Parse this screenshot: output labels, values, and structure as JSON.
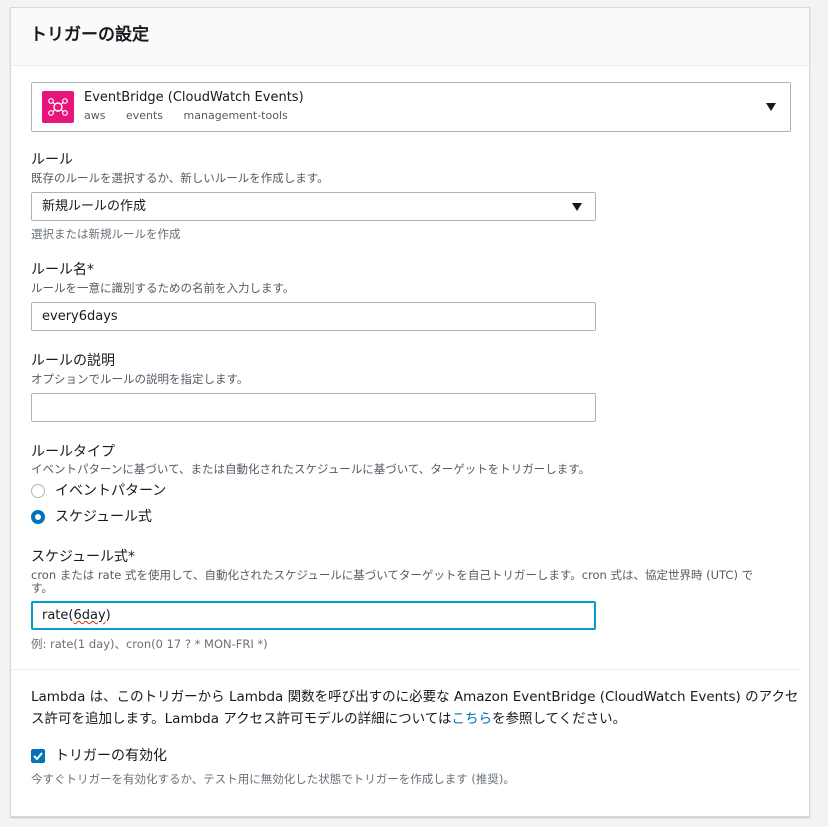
{
  "panel": {
    "title": "トリガーの設定"
  },
  "service": {
    "name": "EventBridge (CloudWatch Events)",
    "tags": [
      "aws",
      "events",
      "management-tools"
    ],
    "icon": "eventbridge-icon",
    "icon_color": "#e7157b"
  },
  "rule": {
    "label": "ルール",
    "description": "既存のルールを選択するか、新しいルールを作成します。",
    "selected": "新規ルールの作成",
    "hint": "選択または新規ルールを作成"
  },
  "rule_name": {
    "label": "ルール名*",
    "description": "ルールを一意に識別するための名前を入力します。",
    "value": "every6days"
  },
  "rule_description": {
    "label": "ルールの説明",
    "description": "オプションでルールの説明を指定します。",
    "value": ""
  },
  "rule_type": {
    "label": "ルールタイプ",
    "description": "イベントパターンに基づいて、または自動化されたスケジュールに基づいて、ターゲットをトリガーします。",
    "options": [
      {
        "label": "イベントパターン",
        "checked": false
      },
      {
        "label": "スケジュール式",
        "checked": true
      }
    ]
  },
  "schedule": {
    "label": "スケジュール式*",
    "description_line1": "cron または rate 式を使用して、自動化されたスケジュールに基づいてターゲットを自己トリガーします。cron 式は、協定世界時 (UTC) で",
    "description_line2": "す。",
    "value_prefix": "rate(",
    "value_misspelled": "6day",
    "value_suffix": ")",
    "example": "例: rate(1 day)、cron(0 17 ? * MON-FRI *)"
  },
  "permission_note": {
    "line1": "Lambda は、このトリガーから Lambda 関数を呼び出すのに必要な Amazon EventBridge (CloudWatch Events) のアクセ",
    "line2_before": "ス許可を追加します。Lambda アクセス許可モデルの詳細については",
    "link": "こちら",
    "line2_after": "を参照してください。"
  },
  "enable_trigger": {
    "label": "トリガーの有効化",
    "checked": true,
    "description": "今すぐトリガーを有効化するか、テスト用に無効化した状態でトリガーを作成します (推奨)。"
  },
  "colors": {
    "accent": "#0073bb",
    "focus": "#00a1c9"
  }
}
